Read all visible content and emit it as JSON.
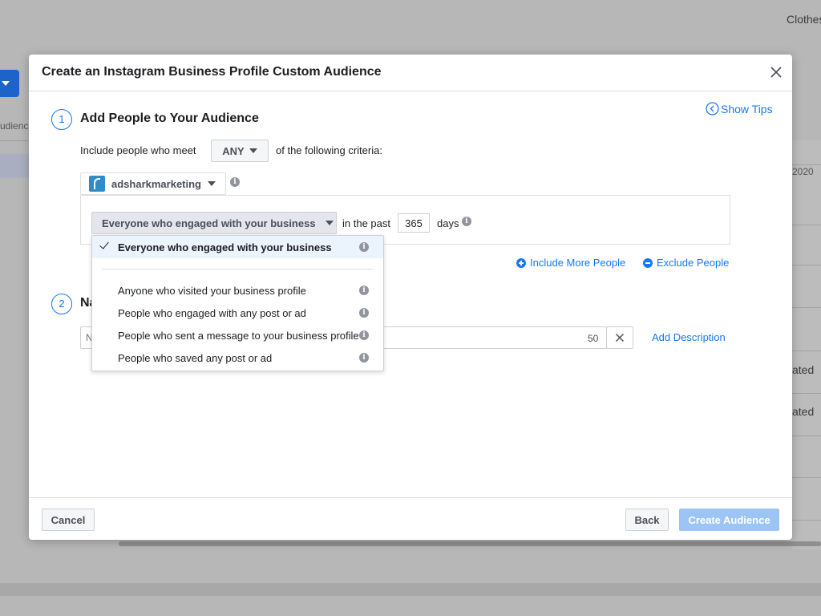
{
  "background": {
    "top_right_text": "Clothes",
    "left_text": "udience",
    "right_date": "2020",
    "right_stats": [
      "ated",
      "ated"
    ]
  },
  "modal": {
    "title": "Create an Instagram Business Profile Custom Audience",
    "show_tips": "Show Tips",
    "step1": {
      "number": "1",
      "title": "Add People to Your Audience",
      "include_label": "Include people who meet",
      "match_mode": "ANY",
      "criteria_label": "of the following criteria:",
      "account": "adsharkmarketing",
      "event": "Everyone who engaged with your business",
      "past_label": "in the past",
      "days_value": "365",
      "days_label": "days",
      "include_more": "Include More People",
      "exclude": "Exclude People"
    },
    "step2": {
      "number": "2",
      "title_partial": "Na",
      "input_placeholder": "N",
      "char_count": "50",
      "add_description": "Add Description"
    },
    "dropdown": {
      "items": [
        {
          "label": "Everyone who engaged with your business",
          "selected": true
        },
        {
          "label": "Anyone who visited your business profile",
          "selected": false
        },
        {
          "label": "People who engaged with any post or ad",
          "selected": false
        },
        {
          "label": "People who sent a message to your business profile",
          "selected": false
        },
        {
          "label": "People who saved any post or ad",
          "selected": false
        }
      ]
    },
    "footer": {
      "cancel": "Cancel",
      "back": "Back",
      "create": "Create Audience"
    }
  },
  "colors": {
    "accent": "#1877f2",
    "disabled_button": "#9cc4f5",
    "overlay": "#b7b7b7"
  }
}
